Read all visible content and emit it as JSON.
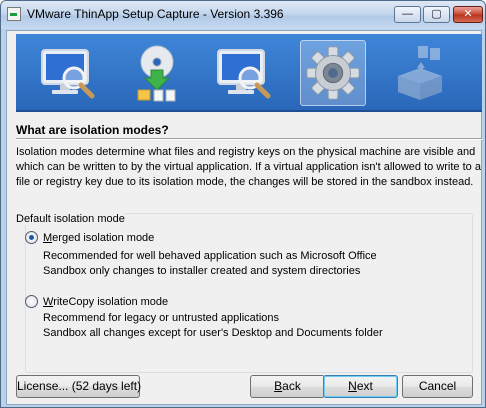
{
  "window": {
    "title": "VMware ThinApp Setup Capture - Version 3.396",
    "controls": {
      "minimize": "—",
      "maximize": "▢",
      "close": "✕"
    }
  },
  "banner": {
    "steps": [
      {
        "icon": "monitor-magnifier-icon",
        "active": false
      },
      {
        "icon": "cd-install-icon",
        "active": false
      },
      {
        "icon": "monitor-magnifier-icon",
        "active": false
      },
      {
        "icon": "gear-icon",
        "active": true
      },
      {
        "icon": "package-box-icon",
        "active": false
      }
    ]
  },
  "page": {
    "heading": "What are isolation modes?",
    "description": [
      "Isolation modes determine what files and registry keys on the physical machine are visible  and",
      "which can be written to by the virtual application. If a virtual application isn't allowed to write to a",
      "file or registry key due to its isolation mode, the changes will be stored in the sandbox instead."
    ]
  },
  "isolation_group": {
    "label": "Default isolation mode",
    "options": [
      {
        "label_underlined": "M",
        "label_rest": "erged isolation mode",
        "selected": true,
        "details": [
          "Recommended for well behaved application such as Microsoft Office",
          "Sandbox only changes to installer created and system directories"
        ]
      },
      {
        "label_underlined": "W",
        "label_rest": "riteCopy isolation mode",
        "selected": false,
        "details": [
          "Recommend for legacy or untrusted applications",
          "Sandbox all changes except for user's Desktop and Documents folder"
        ]
      }
    ]
  },
  "buttons": {
    "license": "License... (52 days left)",
    "back_u": "B",
    "back_rest": "ack",
    "next_u": "N",
    "next_rest": "ext",
    "cancel": "Cancel"
  },
  "colors": {
    "banner_top": "#3f86d8",
    "banner_bottom": "#2a67b9",
    "dialog_bg": "#f0f0f0"
  }
}
